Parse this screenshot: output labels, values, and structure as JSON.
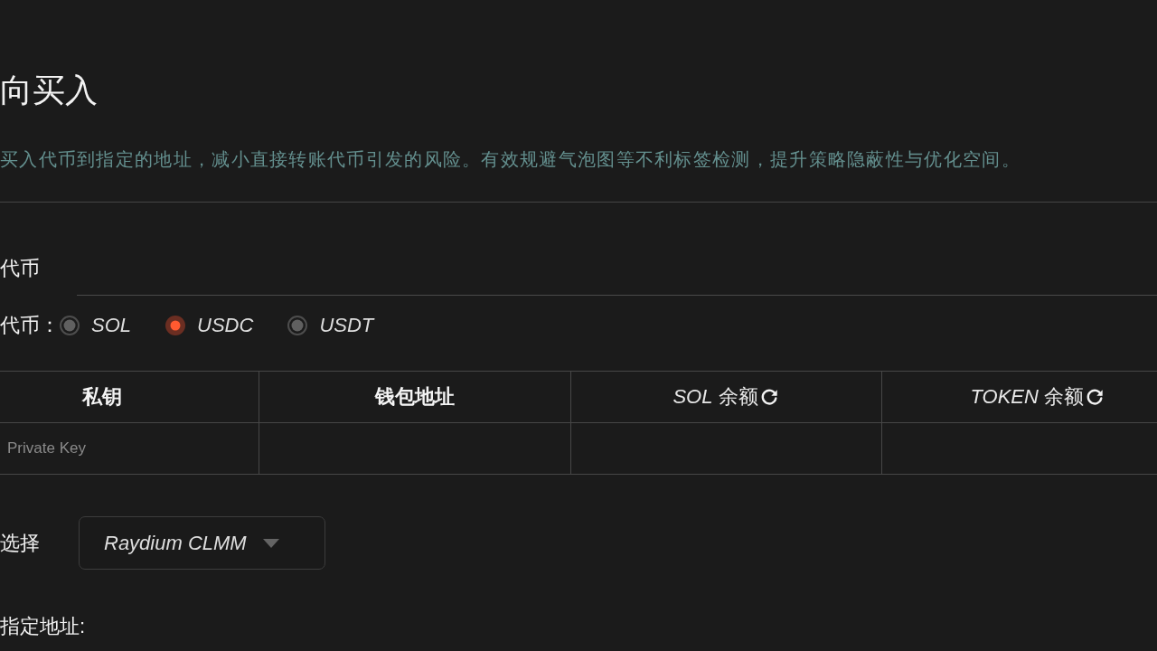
{
  "page": {
    "title": "向买入",
    "description": "买入代币到指定的地址，减小直接转账代币引发的风险。有效规避气泡图等不利标签检测，提升策略隐蔽性与优化空间。"
  },
  "token_section": {
    "label": "代币"
  },
  "currency": {
    "label": "代币：",
    "options": [
      {
        "label": "SOL",
        "selected": false
      },
      {
        "label": "USDC",
        "selected": true
      },
      {
        "label": "USDT",
        "selected": false
      }
    ]
  },
  "wallet_table": {
    "columns": [
      {
        "label": "私钥",
        "kind": "text"
      },
      {
        "label": "钱包地址",
        "kind": "text"
      },
      {
        "label": "*SOL* 余额",
        "kind": "balance"
      },
      {
        "label": "*TOKEN* 余额",
        "kind": "balance"
      }
    ],
    "rows": [
      {
        "private_key": {
          "placeholder": "Private Key"
        }
      }
    ]
  },
  "dex": {
    "label": "选择",
    "value": "Raydium CLMM"
  },
  "target_address": {
    "label": "指定地址:"
  }
}
